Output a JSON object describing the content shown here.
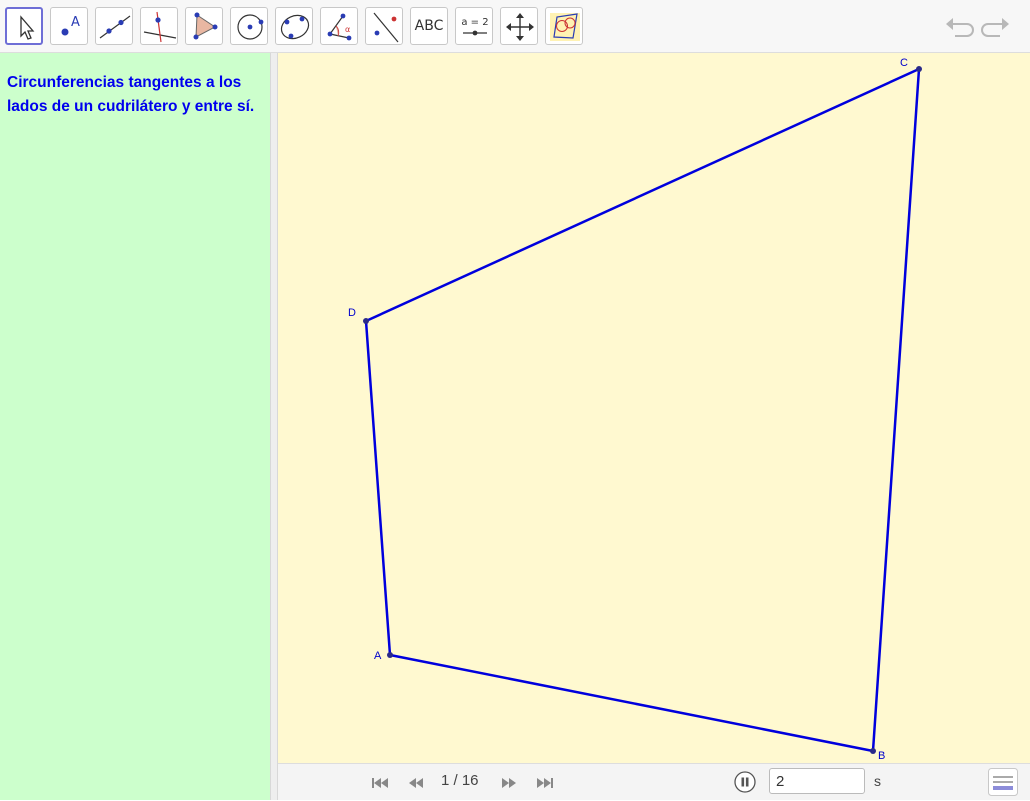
{
  "toolbar": {
    "tools": [
      {
        "name": "move-tool",
        "icon": "arrow-pointer-icon",
        "selected": true
      },
      {
        "name": "point-tool",
        "icon": "point-icon",
        "label": "A"
      },
      {
        "name": "line-tool",
        "icon": "line-through-points-icon"
      },
      {
        "name": "perpendicular-line-tool",
        "icon": "perpendicular-line-icon"
      },
      {
        "name": "polygon-tool",
        "icon": "polygon-icon"
      },
      {
        "name": "circle-center-point-tool",
        "icon": "circle-center-icon"
      },
      {
        "name": "conic-five-points-tool",
        "icon": "ellipse-icon"
      },
      {
        "name": "angle-tool",
        "icon": "angle-icon"
      },
      {
        "name": "reflect-tool",
        "icon": "reflect-about-line-icon"
      },
      {
        "name": "text-tool",
        "icon": "text-icon",
        "label": "ABC"
      },
      {
        "name": "slider-tool",
        "icon": "slider-icon",
        "label": "a = 2"
      },
      {
        "name": "move-graphics-view-tool",
        "icon": "move-graphics-icon"
      },
      {
        "name": "custom-tool",
        "icon": "custom-tool-icon"
      }
    ],
    "undo_icon": "undo-icon",
    "redo_icon": "redo-icon"
  },
  "sidebar": {
    "text": "Circunferencias tangentes a los lados de un cudrilátero y entre sí.",
    "background": "#ccffcc",
    "text_color": "#0000ee"
  },
  "canvas": {
    "background": "#fff9d0",
    "polygon_color": "#0000dd",
    "points": [
      {
        "label": "A"
      },
      {
        "label": "B"
      },
      {
        "label": "C"
      },
      {
        "label": "D"
      }
    ]
  },
  "navigation": {
    "step_text": "1 / 16",
    "speed_value": "2",
    "speed_unit": "s",
    "first_icon": "skip-first-icon",
    "prev_icon": "skip-back-icon",
    "next_icon": "skip-forward-icon",
    "last_icon": "skip-last-icon",
    "pause_icon": "pause-icon",
    "algebra_icon": "algebra-view-icon"
  }
}
